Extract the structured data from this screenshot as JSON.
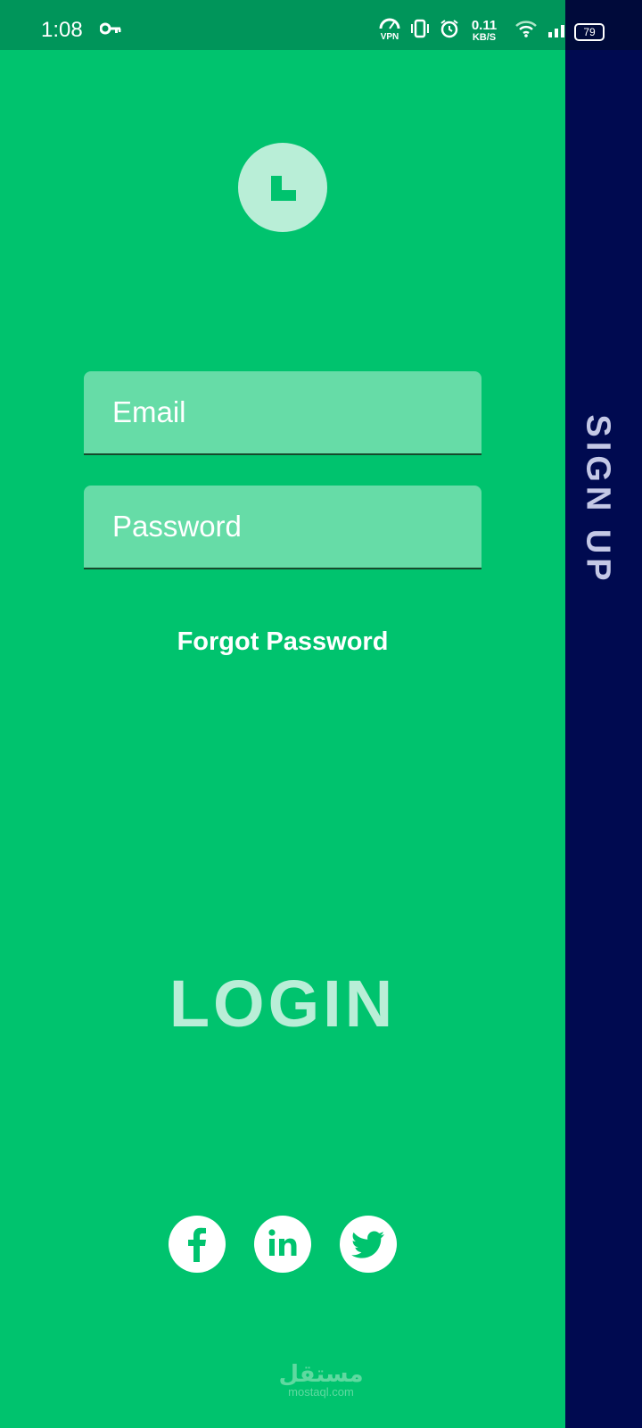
{
  "status_bar": {
    "time": "1:08",
    "network_speed_value": "0.11",
    "network_speed_unit": "KB/S",
    "vpn_label": "VPN",
    "battery_level": "79",
    "icons": [
      "key-icon",
      "vpn-icon",
      "vibrate-icon",
      "alarm-icon",
      "wifi-icon",
      "signal-icon",
      "battery-icon"
    ]
  },
  "logo": {
    "icon": "l-logo-icon"
  },
  "form": {
    "email_placeholder": "Email",
    "password_placeholder": "Password",
    "forgot_label": "Forgot Password",
    "login_label": "LOGIN"
  },
  "side_panel": {
    "signup_label": "SIGN UP"
  },
  "social": {
    "icons": [
      "facebook-icon",
      "linkedin-icon",
      "twitter-icon"
    ]
  },
  "watermark": {
    "arabic": "مستقل",
    "latin": "mostaql.com"
  },
  "colors": {
    "primary_green": "#00c36e",
    "status_bar_green": "#00955a",
    "field_bg": "#66dca7",
    "light_mint": "#b9eed7",
    "side_panel_navy": "#000a50"
  }
}
